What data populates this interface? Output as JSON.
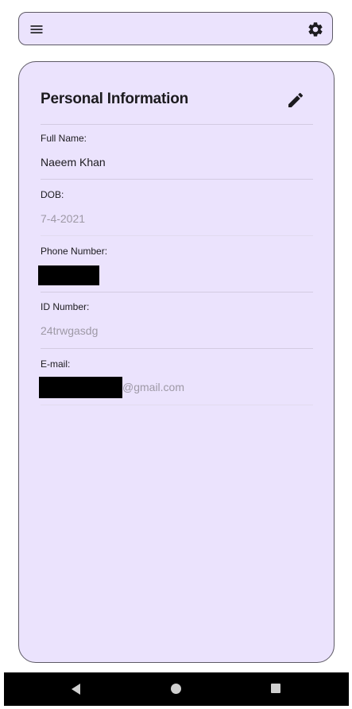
{
  "top_bar": {
    "menu_icon": "menu-icon",
    "settings_icon": "gear-icon"
  },
  "card": {
    "title": "Personal Information",
    "edit_icon": "pencil-icon",
    "fields": [
      {
        "label": "Full Name:",
        "value": "Naeem Khan"
      },
      {
        "label": "DOB:",
        "value": "7-4-2021"
      },
      {
        "label": "Phone Number:",
        "value": ""
      },
      {
        "label": "ID Number:",
        "value": "24trwgasdg"
      },
      {
        "label": "E-mail:",
        "value": "@gmail.com"
      }
    ]
  },
  "nav_bar": {
    "back_icon": "back-triangle-icon",
    "home_icon": "home-circle-icon",
    "recent_icon": "recent-apps-square-icon"
  },
  "colors": {
    "surface": "#ebe3fd",
    "outline": "#5e5a66",
    "text": "#1c1b1f",
    "muted_text": "#9e99a6",
    "divider": "#d3cbe2",
    "redaction": "#000000"
  }
}
